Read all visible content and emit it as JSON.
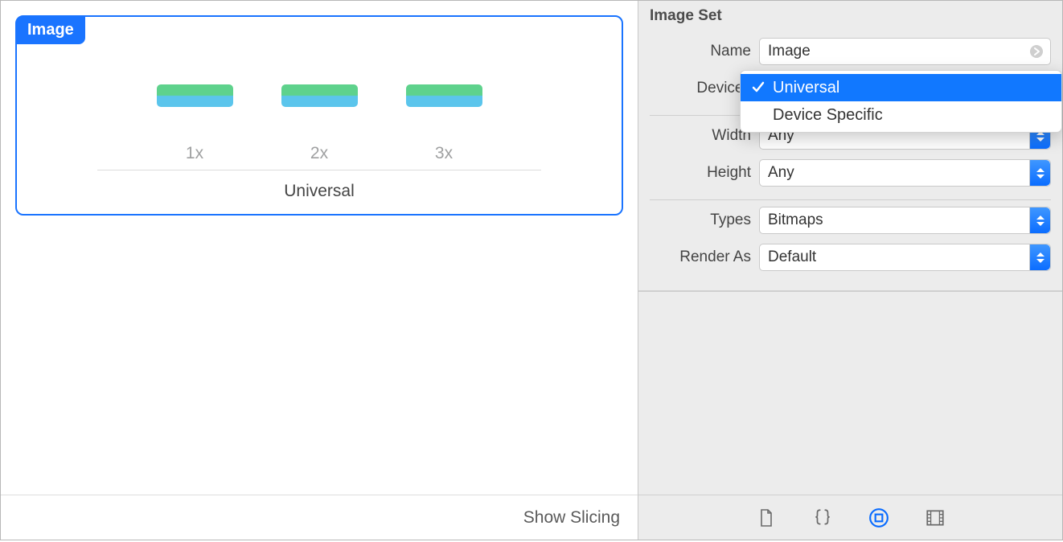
{
  "asset": {
    "title": "Image",
    "wells": [
      "1x",
      "2x",
      "3x"
    ],
    "group_label": "Universal"
  },
  "footer": {
    "show_slicing": "Show Slicing"
  },
  "inspector": {
    "section_title": "Image Set",
    "name": {
      "label": "Name",
      "value": "Image"
    },
    "devices": {
      "label": "Devices",
      "value": "Universal",
      "options": [
        "Universal",
        "Device Specific"
      ]
    },
    "width": {
      "label": "Width",
      "value": "Any"
    },
    "height": {
      "label": "Height",
      "value": "Any"
    },
    "types": {
      "label": "Types",
      "value": "Bitmaps"
    },
    "render_as": {
      "label": "Render As",
      "value": "Default"
    }
  },
  "tabs": [
    "file",
    "braces",
    "outline",
    "slicing"
  ]
}
